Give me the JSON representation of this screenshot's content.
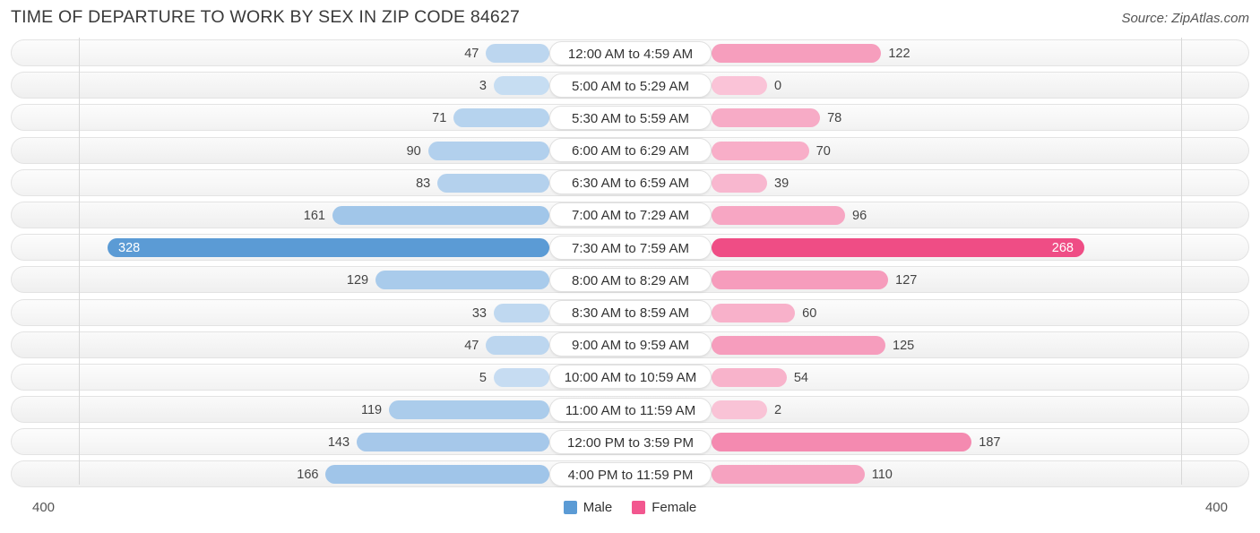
{
  "header": {
    "title": "TIME OF DEPARTURE TO WORK BY SEX IN ZIP CODE 84627",
    "source": "Source: ZipAtlas.com"
  },
  "footer": {
    "axis_max_left": "400",
    "axis_max_right": "400",
    "legend": [
      {
        "label": "Male",
        "color": "#5b9bd5"
      },
      {
        "label": "Female",
        "color": "#f2578f"
      }
    ]
  },
  "colors": {
    "male": "#7aaee0",
    "male_max": "#5b9bd5",
    "female": "#f2719f",
    "female_max": "#ef4d85",
    "track": "#f6f6f6",
    "axis": "#d8d8d8"
  },
  "chart_data": {
    "type": "bar",
    "orientation": "horizontal-diverging",
    "title": "TIME OF DEPARTURE TO WORK BY SEX IN ZIP CODE 84627",
    "xlabel": "",
    "ylabel": "",
    "xlim": [
      400,
      400
    ],
    "axis_max": 400,
    "grid": false,
    "legend_position": "bottom-center",
    "categories": [
      "12:00 AM to 4:59 AM",
      "5:00 AM to 5:29 AM",
      "5:30 AM to 5:59 AM",
      "6:00 AM to 6:29 AM",
      "6:30 AM to 6:59 AM",
      "7:00 AM to 7:29 AM",
      "7:30 AM to 7:59 AM",
      "8:00 AM to 8:29 AM",
      "8:30 AM to 8:59 AM",
      "9:00 AM to 9:59 AM",
      "10:00 AM to 10:59 AM",
      "11:00 AM to 11:59 AM",
      "12:00 PM to 3:59 PM",
      "4:00 PM to 11:59 PM"
    ],
    "series": [
      {
        "name": "Male",
        "color": "#7aaee0",
        "values": [
          47,
          3,
          71,
          90,
          83,
          161,
          328,
          129,
          33,
          47,
          5,
          119,
          143,
          166
        ]
      },
      {
        "name": "Female",
        "color": "#f2719f",
        "values": [
          122,
          0,
          78,
          70,
          39,
          96,
          268,
          127,
          60,
          125,
          54,
          2,
          187,
          110
        ]
      }
    ]
  }
}
